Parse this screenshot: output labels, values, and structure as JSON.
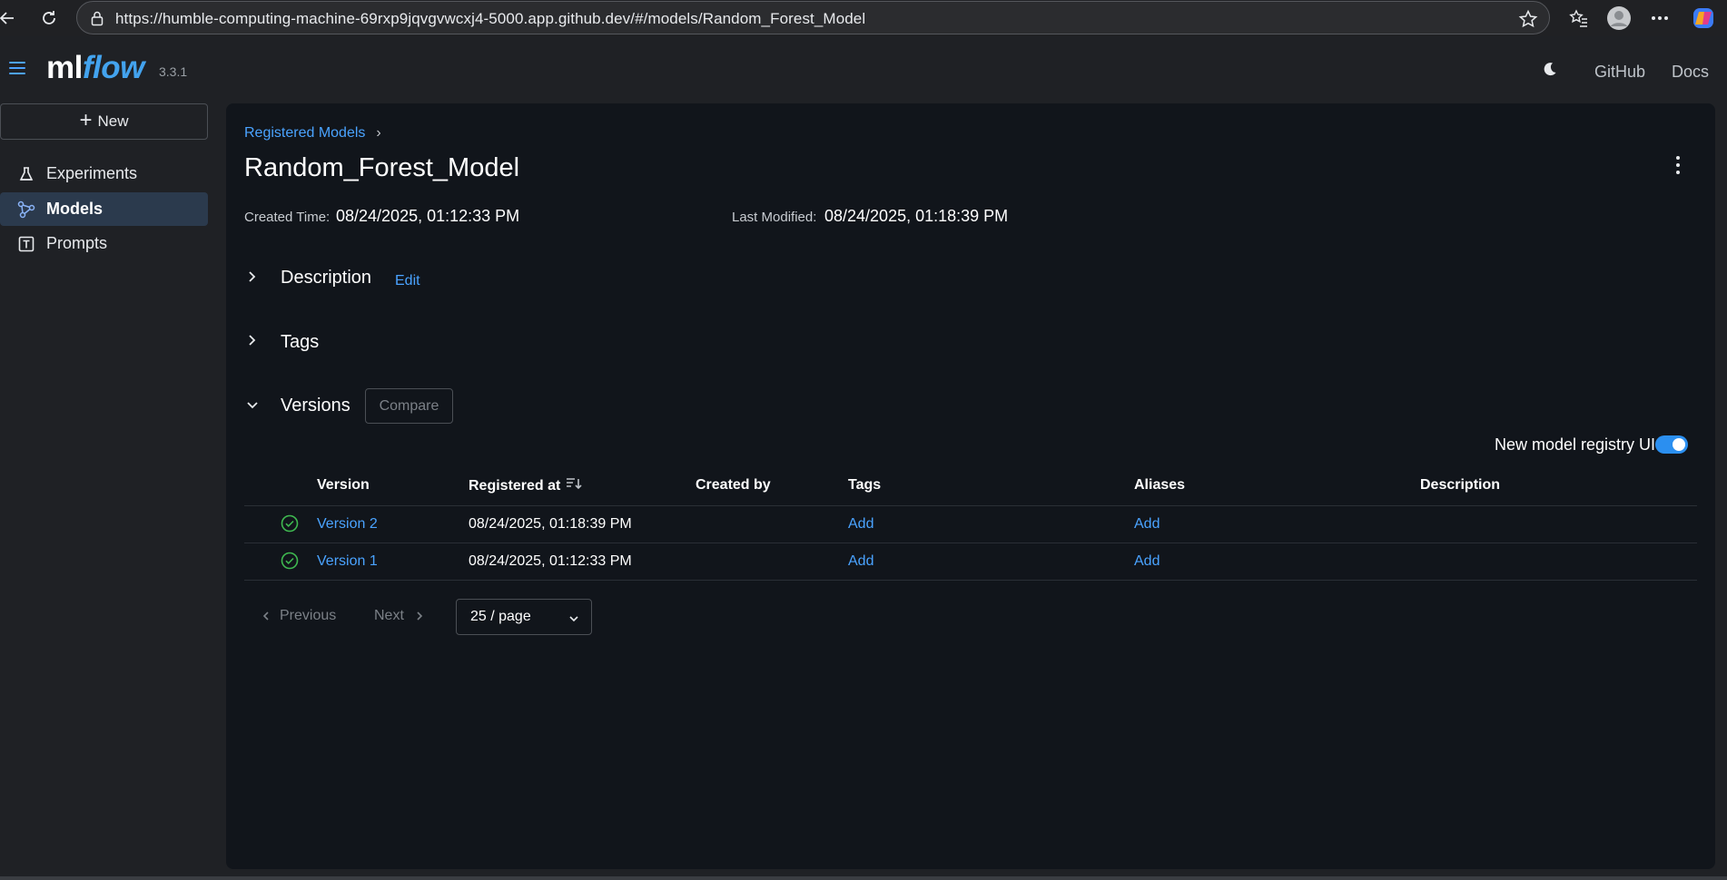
{
  "browser": {
    "url": "https://humble-computing-machine-69rxp9jqvgvwcxj4-5000.app.github.dev/#/models/Random_Forest_Model"
  },
  "header": {
    "logo_main": "ml",
    "logo_accent": "flow",
    "version": "3.3.1",
    "github_label": "GitHub",
    "docs_label": "Docs"
  },
  "sidebar": {
    "new_label": "New",
    "items": [
      {
        "label": "Experiments",
        "icon": "flask-icon"
      },
      {
        "label": "Models",
        "icon": "models-icon"
      },
      {
        "label": "Prompts",
        "icon": "text-box-icon"
      }
    ]
  },
  "main": {
    "breadcrumb": "Registered Models",
    "title": "Random_Forest_Model",
    "created_label": "Created Time:",
    "created_value": "08/24/2025, 01:12:33 PM",
    "modified_label": "Last Modified:",
    "modified_value": "08/24/2025, 01:18:39 PM",
    "description_title": "Description",
    "edit_label": "Edit",
    "tags_title": "Tags",
    "versions_title": "Versions",
    "compare_label": "Compare",
    "toggle_label": "New model registry UI",
    "toggle_on": true
  },
  "table": {
    "headers": [
      "Version",
      "Registered at",
      "Created by",
      "Tags",
      "Aliases",
      "Description"
    ],
    "rows": [
      {
        "version": "Version 2",
        "registered": "08/24/2025, 01:18:39 PM",
        "created_by": "",
        "tags": "Add",
        "aliases": "Add",
        "description": ""
      },
      {
        "version": "Version 1",
        "registered": "08/24/2025, 01:12:33 PM",
        "created_by": "",
        "tags": "Add",
        "aliases": "Add",
        "description": ""
      }
    ]
  },
  "pagination": {
    "previous": "Previous",
    "next": "Next",
    "page_size": "25 / page"
  },
  "colors": {
    "accent": "#4aa3ff",
    "success": "#3fb950",
    "panel_bg": "#11151b",
    "app_bg": "#1f2125"
  }
}
